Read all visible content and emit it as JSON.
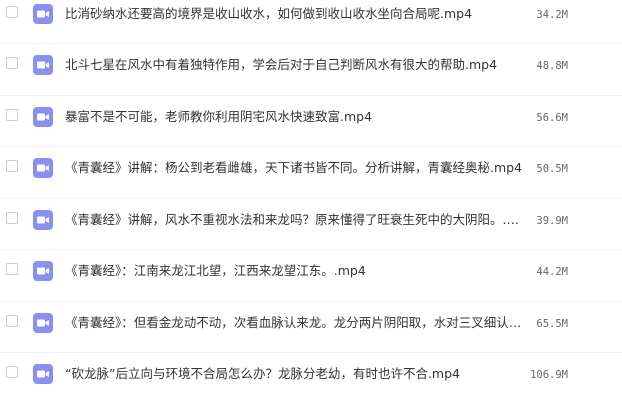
{
  "file_list": {
    "columns": [
      "checkbox",
      "icon",
      "name",
      "size"
    ],
    "icon": "video-file-icon",
    "icon_color": "#8a8ff5",
    "rows": [
      {
        "name": "比消砂纳水还要高的境界是收山收水，如何做到收山收水坐向合局呢.mp4",
        "size": "34.2M"
      },
      {
        "name": "北斗七星在风水中有着独特作用，学会后对于自己判断风水有很大的帮助.mp4",
        "size": "48.8M"
      },
      {
        "name": "暴富不是不可能，老师教你利用阴宅风水快速致富.mp4",
        "size": "56.6M"
      },
      {
        "name": "《青囊经》讲解：杨公到老看雌雄，天下诸书皆不同。分析讲解，青囊经奥秘.mp4",
        "size": "50.5M"
      },
      {
        "name": "《青囊经》讲解，风水不重视水法和来龙吗？原来懂得了旺衰生死中的大阴阳。.mp4",
        "size": "39.9M"
      },
      {
        "name": "《青囊经》：江南来龙江北望，江西来龙望江东。.mp4",
        "size": "44.2M"
      },
      {
        "name": "《青囊经》：但看金龙动不动，次看血脉认来龙。龙分两片阴阳取，水对三叉细认踪…",
        "size": "65.5M"
      },
      {
        "name": "“砍龙脉”后立向与环境不合局怎么办？龙脉分老幼，有时也许不合.mp4",
        "size": "106.9M"
      }
    ]
  }
}
